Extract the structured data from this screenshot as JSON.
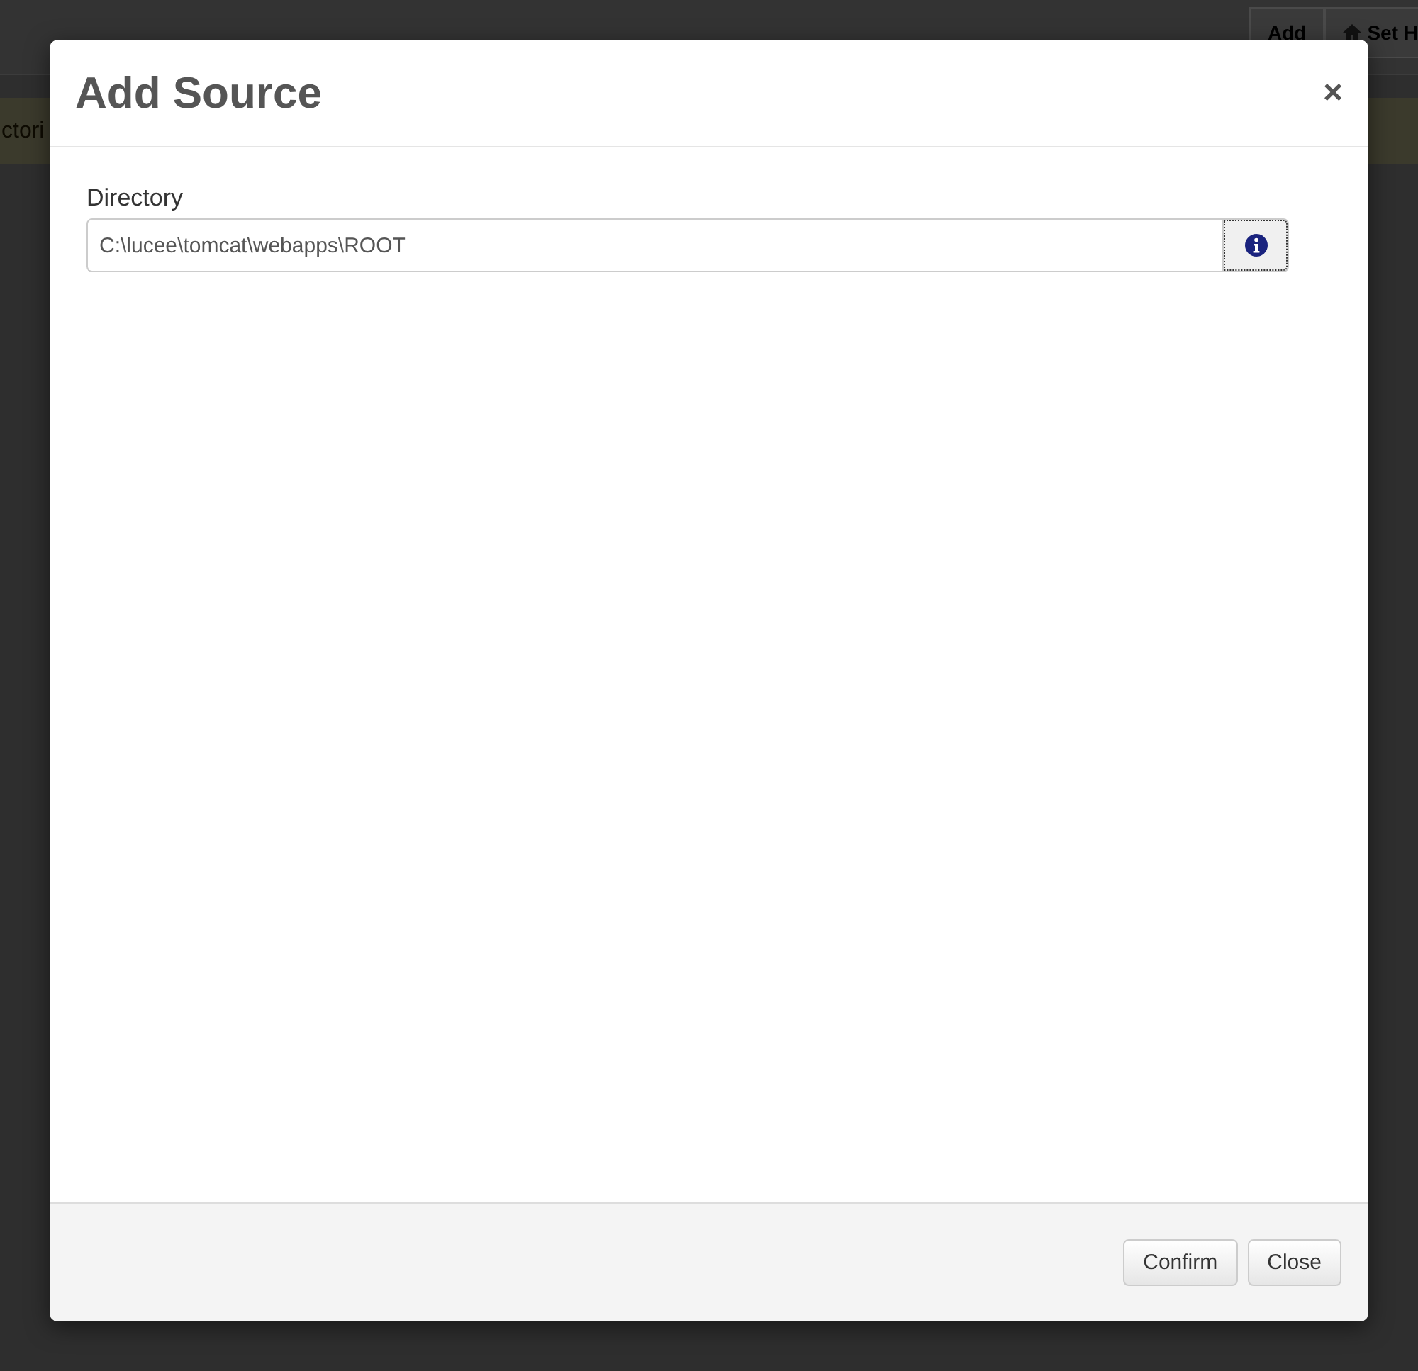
{
  "background": {
    "toolbar_buttons": [
      {
        "label": "Add",
        "kind": "text"
      },
      {
        "label": "Set H",
        "kind": "home"
      }
    ],
    "notice": "ctori"
  },
  "dialog": {
    "title": "Add Source",
    "close": "×",
    "field": {
      "label": "Directory",
      "value": "C:\\lucee\\tomcat\\webapps\\ROOT"
    },
    "buttons": [
      "Confirm",
      "Close"
    ]
  }
}
